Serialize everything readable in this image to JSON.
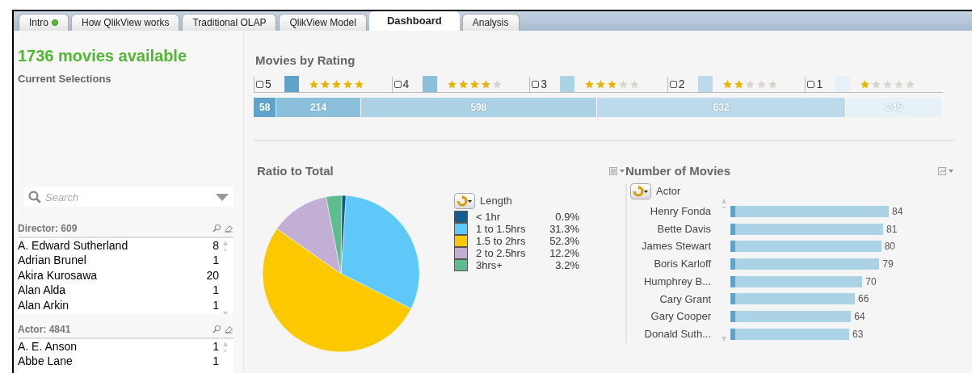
{
  "tabs": [
    {
      "label": "Intro",
      "selected": false,
      "status_dot": true
    },
    {
      "label": "How QlikView works",
      "selected": false,
      "status_dot": false
    },
    {
      "label": "Traditional OLAP",
      "selected": false,
      "status_dot": false
    },
    {
      "label": "QlikView Model",
      "selected": false,
      "status_dot": false
    },
    {
      "label": "Dashboard",
      "selected": true,
      "status_dot": false
    },
    {
      "label": "Analysis",
      "selected": false,
      "status_dot": false
    }
  ],
  "sidebar": {
    "headline": "1736 movies available",
    "current_selections": "Current Selections",
    "search": {
      "placeholder": "Search"
    },
    "list_boxes": [
      {
        "title": "Director: 609",
        "items": [
          {
            "name": "A. Edward Sutherland",
            "count": "8"
          },
          {
            "name": "Adrian Brunel",
            "count": "1"
          },
          {
            "name": "Akira Kurosawa",
            "count": "20"
          },
          {
            "name": "Alan Alda",
            "count": "1"
          },
          {
            "name": "Alan Arkin",
            "count": "1"
          }
        ]
      },
      {
        "title": "Actor: 4841",
        "items": [
          {
            "name": "A. E. Anson",
            "count": "1"
          },
          {
            "name": "Abbe Lane",
            "count": "1"
          }
        ]
      }
    ]
  },
  "movies_by_rating": {
    "title": "Movies by Rating",
    "legend": [
      {
        "label": "5",
        "checked": false,
        "color": "#5fa3c8",
        "stars": 5
      },
      {
        "label": "4",
        "checked": false,
        "color": "#8bbfdc",
        "stars": 4
      },
      {
        "label": "3",
        "checked": false,
        "color": "#acd2e6",
        "stars": 3
      },
      {
        "label": "2",
        "checked": false,
        "color": "#bcdaeb",
        "stars": 2
      },
      {
        "label": "1",
        "checked": false,
        "color": "#e6f1f8",
        "stars": 1
      }
    ],
    "segments": [
      {
        "count": "58",
        "color": "#5fa3c8"
      },
      {
        "count": "214",
        "color": "#8bbfdc"
      },
      {
        "count": "598",
        "color": "#acd2e6"
      },
      {
        "count": "632",
        "color": "#bcdaeb"
      },
      {
        "count": "245",
        "color": "#e6f1f8"
      }
    ]
  },
  "ratio_to_total": {
    "title": "Ratio to Total",
    "legend_title": "Length",
    "legend": [
      {
        "label": "< 1hr",
        "percent": "0.9%",
        "color": "#0e5f8f"
      },
      {
        "label": "1 to 1.5hrs",
        "percent": "31.3%",
        "color": "#5ec8f8"
      },
      {
        "label": "1.5 to 2hrs",
        "percent": "52.3%",
        "color": "#fcc800"
      },
      {
        "label": "2 to 2.5hrs",
        "percent": "12.2%",
        "color": "#c3aed6"
      },
      {
        "label": "3hrs+",
        "percent": "3.2%",
        "color": "#5dbd8e"
      }
    ]
  },
  "number_of_movies": {
    "title": "Number of Movies",
    "dimension": "Actor",
    "rows": [
      {
        "name": "Henry Fonda",
        "count": "84"
      },
      {
        "name": "Bette Davis",
        "count": "81"
      },
      {
        "name": "James Stewart",
        "count": "80"
      },
      {
        "name": "Boris Karloff",
        "count": "79"
      },
      {
        "name": "Humphrey B...",
        "count": "70"
      },
      {
        "name": "Cary Grant",
        "count": "66"
      },
      {
        "name": "Gary Cooper",
        "count": "64"
      },
      {
        "name": "Donald Suth...",
        "count": "63"
      }
    ]
  }
}
